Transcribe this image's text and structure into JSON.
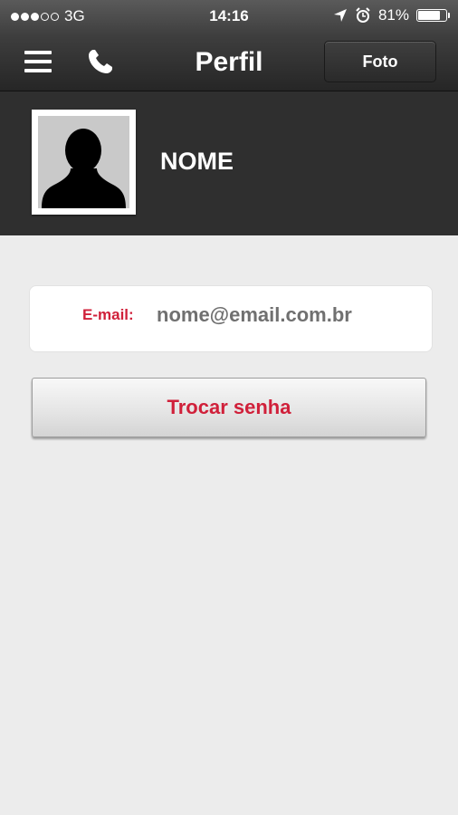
{
  "status_bar": {
    "carrier": "3G",
    "time": "14:16",
    "battery": "81%",
    "battery_level": 0.81,
    "signal_bars_filled": 3,
    "signal_bars_total": 5,
    "icons": [
      "location-arrow-icon",
      "alarm-clock-icon",
      "battery-icon"
    ]
  },
  "navbar": {
    "title": "Perfil",
    "photo_button": "Foto",
    "icons": [
      "menu-icon",
      "phone-icon"
    ]
  },
  "profile": {
    "name": "NOME"
  },
  "email": {
    "label": "E-mail:",
    "value": "nome@email.com.br"
  },
  "actions": {
    "change_password": "Trocar senha"
  },
  "colors": {
    "accent": "#d0203a",
    "header_bg": "#2f2f2f",
    "page_bg": "#ececec"
  }
}
